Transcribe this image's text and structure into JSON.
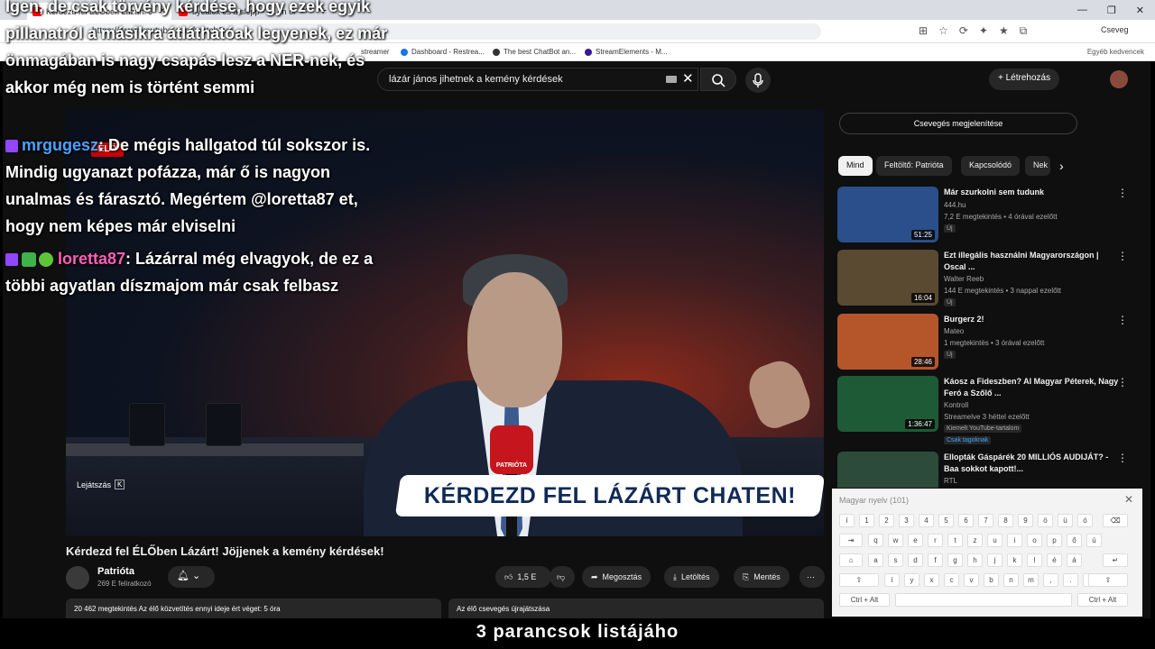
{
  "browser": {
    "tabs": [
      {
        "title": "Kérdezd fel ÉLŐben Lázárt! Jöjjenek"
      },
      {
        "title": "byealex és a slepp - az én országom"
      }
    ],
    "url": "https://www.youtube.com/watch?v=...",
    "copilot_label": "Cseveg",
    "bookmarks": [
      "streamer",
      "Dashboard - Restrea...",
      "The best ChatBot an...",
      "StreamElements - M..."
    ],
    "bookmarks_right": "Egyéb kedvencek"
  },
  "youtube": {
    "search_value": "lázár jános jihetnek a kemény kérdések",
    "create_label": "Létrehozás",
    "live_badge": "ÉLŐ",
    "watch_later": "Lejátszás",
    "watch_later_key": "K",
    "video_banner": "KÉRDEZD FEL LÁZÁRT CHATEN!",
    "mic_brand": "PATRIÓTA",
    "video_title": "Kérdezd fel ÉLŐben Lázárt! Jöjjenek a kemény kérdések!",
    "channel_name": "Patrióta",
    "subscribers": "269 E feliratkozó",
    "like_count": "1,5 E",
    "share_label": "Megosztás",
    "download_label": "Letöltés",
    "save_label": "Mentés",
    "more_label": "⋯",
    "description": "20 462 megtekintés  Az élő közvetítés ennyi ideje ért véget: 5 óra",
    "replay_label": "Az élő csevegés újrajátszása",
    "show_chat": "Csevegés megjelenítése",
    "chips": [
      "Mind",
      "Feltöltő: Patrióta",
      "Kapcsolódó",
      "Nek"
    ],
    "recommendations": [
      {
        "title": "Már szurkolni sem tudunk",
        "channel": "444.hu",
        "meta": "7,2 E megtekintés • 4 órával ezelőtt",
        "tag": "Új",
        "duration": "51:25",
        "color": "#2a4f8a"
      },
      {
        "title": "Ezt illegális használni Magyarországon | Oscal ...",
        "channel": "Walter Reeb",
        "meta": "144 E megtekintés • 3 nappal ezelőtt",
        "tag": "Új",
        "duration": "16:04",
        "color": "#5a4a32"
      },
      {
        "title": "Burgerz 2!",
        "channel": "Mateo",
        "meta": "1 megtekintés • 3 órával ezelőtt",
        "tag": "Új",
        "duration": "28:46",
        "color": "#b5562a"
      },
      {
        "title": "Káosz a Fideszben? AI Magyar Péterek, Nagy Feró a Szőlő ...",
        "channel": "Kontroll",
        "meta": "Streamelve 3 héttel ezelőtt",
        "tag": "Kiemelt YouTube-tartalom",
        "extra": "Csak tagoknak",
        "duration": "1:36:47",
        "color": "#1f5a36"
      },
      {
        "title": "Ellopták Gáspárék 20 MILLIÓS AUDIJÁT? - Baa sokkot kapott!...",
        "channel": "RTL",
        "duration": "",
        "color": "#2d4b3a"
      }
    ]
  },
  "chat_overlay": {
    "top_caption": "Igen, de csak törvény kérdése, hogy ezek egyik pillanatról a másikra átláthatóak legyenek, ez már önmagában is nagy csapás lesz a NER-nek, és akkor még nem is történt semmi",
    "messages": [
      {
        "user": "mrgugesz",
        "text": ": De mégis hallgatod túl sokszor is. Mindig ugyanazt pofázza, már ő is nagyon unalmas és fárasztó. Megértem @loretta87 et, hogy nem képes már elviselni"
      },
      {
        "user": "loretta87",
        "text": ": Lázárral még elvagyok, de ez a többi agyatlan díszmajom már csak felbasz"
      }
    ]
  },
  "keyboard": {
    "title": "Magyar nyelv (101)",
    "row1": [
      "í",
      "1",
      "2",
      "3",
      "4",
      "5",
      "6",
      "7",
      "8",
      "9",
      "ö",
      "ü",
      "ó"
    ],
    "row2": [
      "q",
      "w",
      "e",
      "r",
      "t",
      "z",
      "u",
      "i",
      "o",
      "p",
      "ő",
      "ú"
    ],
    "row3": [
      "a",
      "s",
      "d",
      "f",
      "g",
      "h",
      "j",
      "k",
      "l",
      "é",
      "á"
    ],
    "row4": [
      "í",
      "y",
      "x",
      "c",
      "v",
      "b",
      "n",
      "m",
      ",",
      ".",
      "-"
    ],
    "ctrl_alt": "Ctrl + Alt"
  },
  "bottom_caption": "3 parancsok listájáho"
}
